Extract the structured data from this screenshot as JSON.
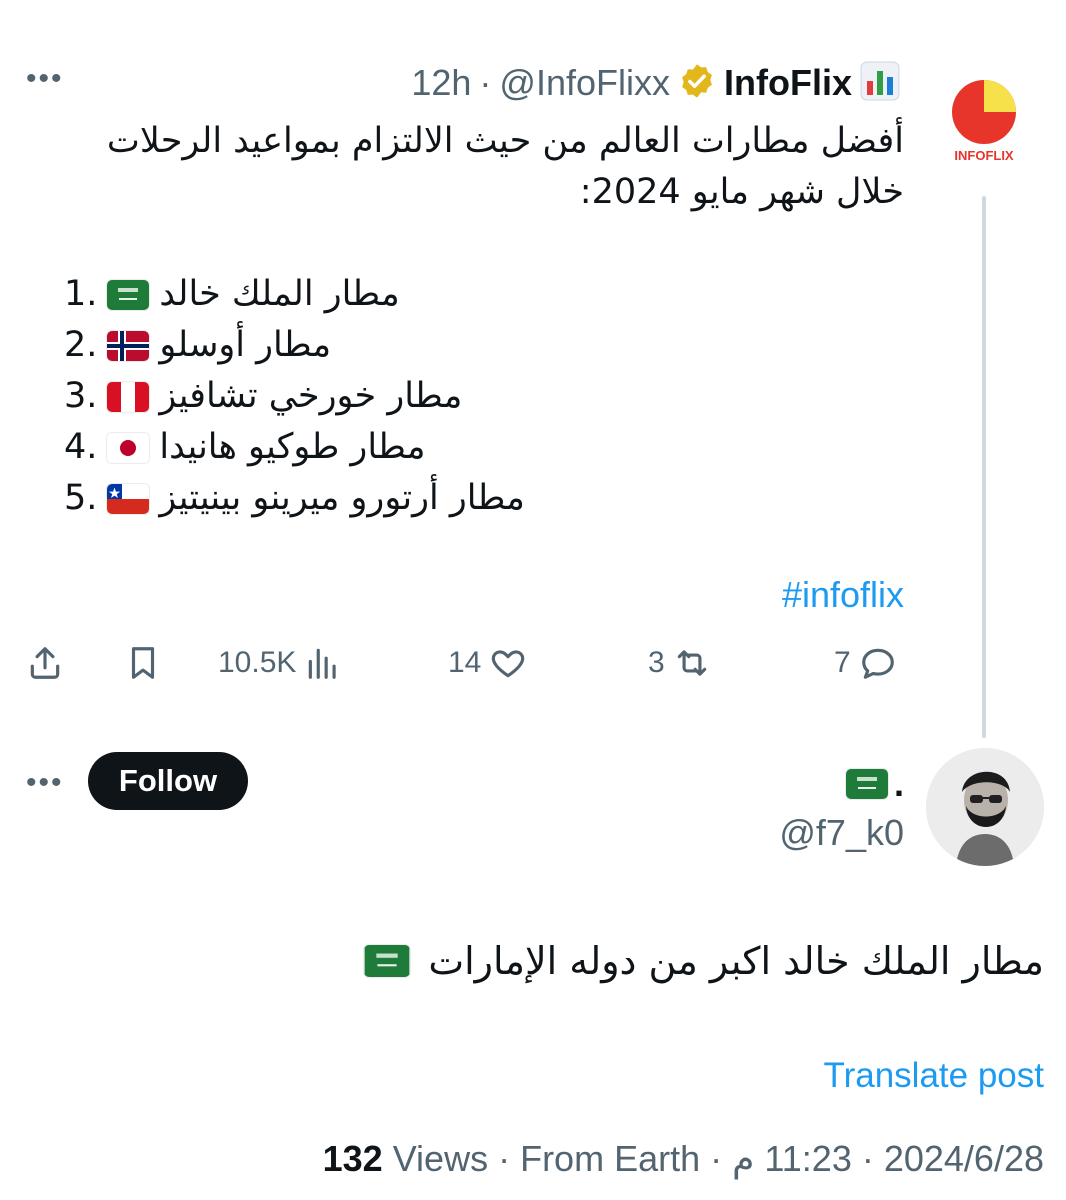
{
  "tweet": {
    "author": {
      "name": "InfoFlix",
      "name_emoji": "chart-emoji",
      "verified_badge": "gold-verified-badge-icon",
      "handle": "@InfoFlixx",
      "time": "12h",
      "separator": "·",
      "avatar_text": "INFOFLIX"
    },
    "more_label": "•••",
    "intro_line1": "أفضل مطارات العالم من حيث الالتزام بمواعيد الرحلات",
    "intro_line2": "خلال شهر مايو 2024:",
    "rankings": [
      {
        "num": "1.",
        "flag": "saudi-arabia-flag",
        "name": "مطار الملك خالد"
      },
      {
        "num": "2.",
        "flag": "norway-flag",
        "name": "مطار أوسلو"
      },
      {
        "num": "3.",
        "flag": "peru-flag",
        "name": "مطار خورخي تشافيز"
      },
      {
        "num": "4.",
        "flag": "japan-flag",
        "name": "مطار طوكيو هانيدا"
      },
      {
        "num": "5.",
        "flag": "chile-flag",
        "name": "مطار أرتورو ميرينو بينيتيز"
      }
    ],
    "hashtag": "#infoflix",
    "actions": {
      "views": "10.5K",
      "likes": "14",
      "retweets": "3",
      "replies": "7"
    }
  },
  "reply": {
    "name_suffix": ".",
    "name_flag": "saudi-arabia-flag",
    "handle": "@f7_k0",
    "follow_label": "Follow",
    "more_label": "•••",
    "text": "مطار الملك خالد اكبر من دوله  الإمارات",
    "text_flag": "saudi-arabia-flag",
    "translate_label": "Translate post",
    "date": "2024/6/28",
    "dot1": " · ",
    "time": "11:23 م",
    "dot2": " · ",
    "from": "From Earth",
    "views_count": "132",
    "views_label": " Views"
  },
  "colors": {
    "link": "#1d9bf0",
    "muted": "#536471",
    "text": "#0f1419",
    "gold_badge": "#e2b719",
    "thread_line": "#cfd9de"
  }
}
